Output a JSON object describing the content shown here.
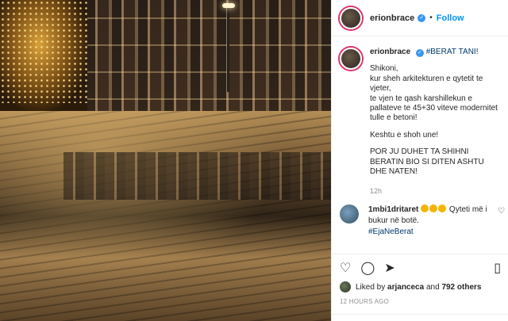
{
  "post": {
    "author": "erionbrace",
    "follow_label": "Follow",
    "separator": "•",
    "caption": {
      "hashtag_title": "#BERAT",
      "title_rest": "TANI!",
      "lines": [
        "Shikoni,",
        "kur sheh arkitekturen e qytetit te vjeter,",
        "te vjen te qash karshillekun e pallateve te 45+30 viteve modernitet tulle e betoni!",
        "Keshtu e shoh une!",
        "POR JU DUHET TA SHIHNI BERATIN BIO SI DITEN ASHTU DHE NATEN!"
      ],
      "time_ago": "12h"
    },
    "comments": [
      {
        "user": "1mbi1dritaret",
        "text": "Qyteti më i bukur në botë.",
        "hashtag": "#EjaNeBerat"
      }
    ],
    "likes": {
      "prefix": "Liked by",
      "first_user": "arjanceca",
      "conjunction": "and",
      "others": "792 others"
    },
    "posted_ago": "12 HOURS AGO"
  },
  "icons": {
    "verified": "verified-badge-icon",
    "like": "heart-icon",
    "comment": "comment-icon",
    "share": "share-icon",
    "save": "bookmark-icon"
  },
  "colors": {
    "follow": "#0095f6",
    "verified": "#3897f0",
    "hashtag": "#00376b",
    "story_ring": "#e1306c"
  }
}
